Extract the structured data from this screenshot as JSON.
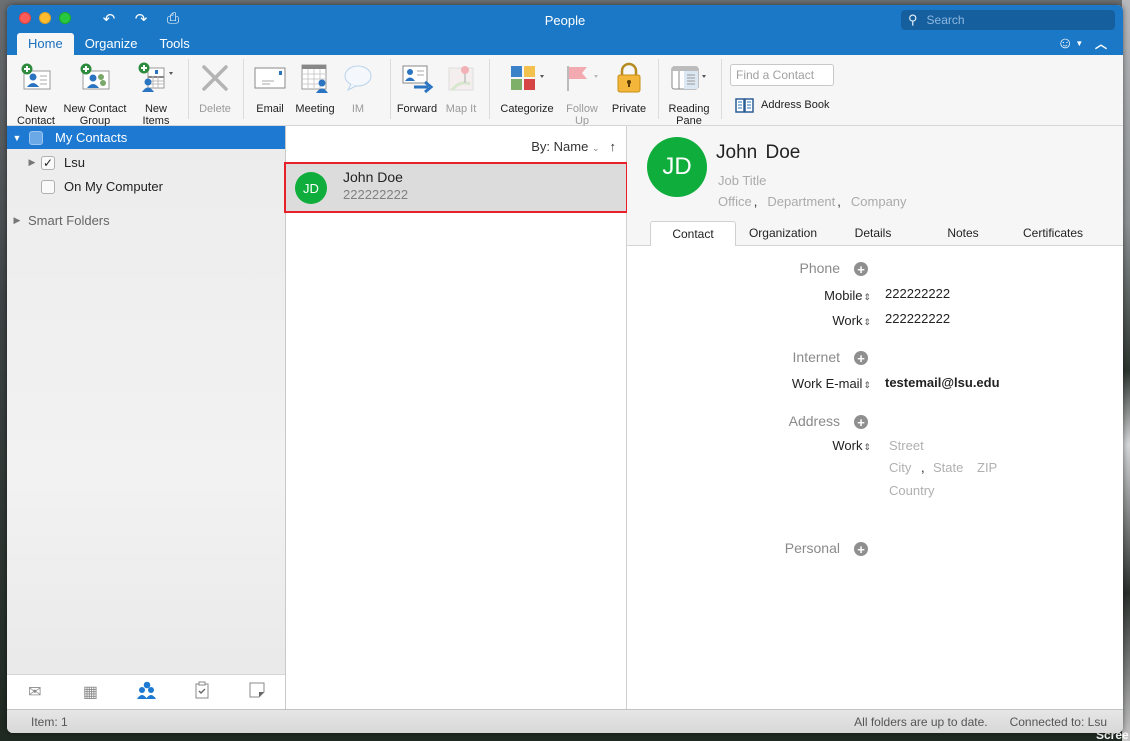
{
  "window": {
    "title": "People",
    "search_placeholder": "Search"
  },
  "quick_access": {
    "undo_icon": "undo-icon",
    "redo_icon": "redo-icon",
    "print_icon": "print-icon"
  },
  "ribbon_tabs": [
    {
      "label": "Home",
      "active": true
    },
    {
      "label": "Organize",
      "active": false
    },
    {
      "label": "Tools",
      "active": false
    }
  ],
  "ribbon": {
    "new_contact": "New\nContact",
    "new_contact_l1": "New",
    "new_contact_l2": "Contact",
    "new_group_l1": "New Contact",
    "new_group_l2": "Group",
    "new_items_l1": "New",
    "new_items_l2": "Items",
    "delete": "Delete",
    "email": "Email",
    "meeting": "Meeting",
    "im": "IM",
    "forward": "Forward",
    "map_it": "Map It",
    "categorize": "Categorize",
    "follow_up_l1": "Follow",
    "follow_up_l2": "Up",
    "private": "Private",
    "reading_pane_l1": "Reading",
    "reading_pane_l2": "Pane",
    "find_contact_placeholder": "Find a Contact",
    "address_book": "Address Book"
  },
  "sidebar": {
    "my_contacts": "My Contacts",
    "folders": [
      {
        "label": "Lsu",
        "checked": true,
        "expandable": true
      },
      {
        "label": "On My Computer",
        "checked": false,
        "expandable": false
      }
    ],
    "smart_folders": "Smart Folders",
    "nav": [
      {
        "name": "mail",
        "icon": "✉",
        "active": false
      },
      {
        "name": "calendar",
        "icon": "▦",
        "active": false
      },
      {
        "name": "people",
        "icon": "👥",
        "active": true
      },
      {
        "name": "tasks",
        "icon": "☑",
        "active": false
      },
      {
        "name": "notes",
        "icon": "◳",
        "active": false
      }
    ]
  },
  "list": {
    "sort_label": "By: Name",
    "items": [
      {
        "initials": "JD",
        "name": "John Doe",
        "phone": "222222222",
        "selected": true
      }
    ]
  },
  "detail": {
    "initials": "JD",
    "name": "John  Doe",
    "job_title_placeholder": "Job Title",
    "office_placeholder": "Office",
    "department_placeholder": "Department",
    "company_placeholder": "Company",
    "tabs": [
      {
        "label": "Contact",
        "active": true
      },
      {
        "label": "Organization",
        "active": false
      },
      {
        "label": "Details",
        "active": false
      },
      {
        "label": "Notes",
        "active": false
      },
      {
        "label": "Certificates",
        "active": false
      }
    ],
    "phone_section": "Phone",
    "phones": [
      {
        "label": "Mobile",
        "value": "222222222"
      },
      {
        "label": "Work",
        "value": "222222222"
      }
    ],
    "internet_section": "Internet",
    "emails": [
      {
        "label": "Work E-mail",
        "value": "testemail@lsu.edu"
      }
    ],
    "address_section": "Address",
    "address": {
      "label": "Work",
      "street_placeholder": "Street",
      "city_placeholder": "City",
      "state_placeholder": "State",
      "zip_placeholder": "ZIP",
      "country_placeholder": "Country"
    },
    "personal_section": "Personal"
  },
  "status": {
    "items": "Item: 1",
    "sync": "All folders are up to date.",
    "connection": "Connected to: Lsu"
  },
  "colors": {
    "accent": "#1b78c6",
    "avatar": "#0fae3c",
    "selection_outline": "#e8202a"
  }
}
